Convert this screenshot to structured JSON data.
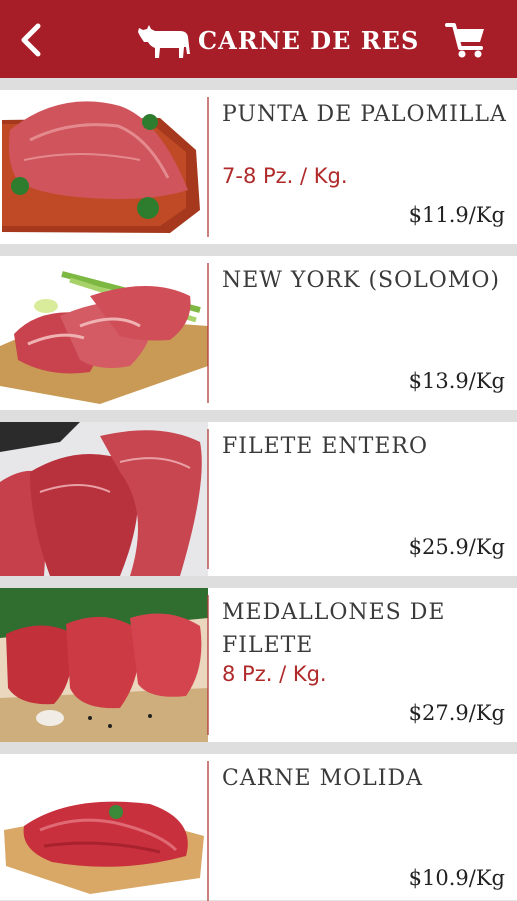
{
  "header": {
    "title": "CARNE DE RES",
    "back_icon": "back-arrow-icon",
    "logo_icon": "cow-icon",
    "cart_icon": "shopping-cart-icon",
    "brand_color": "#a71e28"
  },
  "products": [
    {
      "name": "PUNTA DE PALOMILLA",
      "quantity": "7-8 Pz. / Kg.",
      "price": "$11.9/Kg",
      "image": "beef-roast-on-board"
    },
    {
      "name": "NEW YORK (SOLOMO)",
      "quantity": "",
      "price": "$13.9/Kg",
      "image": "steaks-on-board"
    },
    {
      "name": "FILETE ENTERO",
      "quantity": "",
      "price": "$25.9/Kg",
      "image": "raw-fillet-pieces"
    },
    {
      "name": "MEDALLONES DE FILETE",
      "quantity": "8 Pz. / Kg.",
      "price": "$27.9/Kg",
      "image": "fillet-medallions"
    },
    {
      "name": "CARNE MOLIDA",
      "quantity": "",
      "price": "$10.9/Kg",
      "image": "ground-beef-on-board"
    }
  ]
}
